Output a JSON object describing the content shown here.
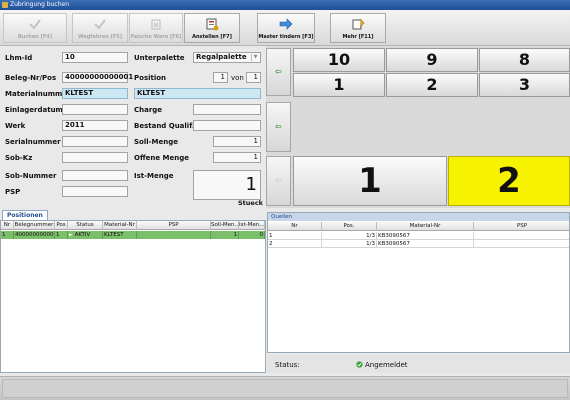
{
  "window": {
    "title": "Zubringung buchen"
  },
  "toolbar": {
    "buttons": [
      {
        "label": "Buchen [F4]",
        "icon": "check-icon",
        "enabled": false
      },
      {
        "label": "Wegfahren [F5]",
        "icon": "check-icon",
        "enabled": false
      },
      {
        "label": "Falsche Ware [F6]",
        "icon": "wrong-goods-icon",
        "enabled": false
      },
      {
        "label": "Anstellen [F7]",
        "icon": "queue-icon",
        "enabled": true
      },
      {
        "label": "Master tindern [F3]",
        "icon": "arrow-right-icon",
        "enabled": true
      },
      {
        "label": "Mehr [F11]",
        "icon": "more-icon",
        "enabled": true
      }
    ]
  },
  "form": {
    "lhm_id": {
      "label": "Lhm-Id",
      "value": "10"
    },
    "unterpalette": {
      "label": "Unterpalette",
      "value": "Regalpalette"
    },
    "beleg": {
      "label": "Beleg-Nr/Pos",
      "value": "40000000000001"
    },
    "position": {
      "label": "Position",
      "value": "1",
      "von_label": "von",
      "von_value": "1"
    },
    "materialnummer": {
      "label": "Materialnummer",
      "value": "KLTEST"
    },
    "material_text": {
      "value": "KLTEST"
    },
    "einlagerdatum": {
      "label": "Einlagerdatum",
      "value": ""
    },
    "charge": {
      "label": "Charge",
      "value": ""
    },
    "werk": {
      "label": "Werk",
      "value": "2011"
    },
    "bestand_qualif": {
      "label": "Bestand Qualif.",
      "value": ""
    },
    "serialnummer": {
      "label": "Serialnummer",
      "value": ""
    },
    "soll_menge": {
      "label": "Soll-Menge",
      "value": "1"
    },
    "sob_kz": {
      "label": "Sob-Kz",
      "value": ""
    },
    "offene_menge": {
      "label": "Offene Menge",
      "value": "1"
    },
    "sob_nummer": {
      "label": "Sob-Nummer",
      "value": ""
    },
    "ist_menge": {
      "label": "Ist-Menge",
      "value": "1",
      "unit": "Stueck"
    },
    "psp": {
      "label": "PSP",
      "value": ""
    }
  },
  "numpad": {
    "nav_icons": [
      "arrow-left-icon",
      "arrow-left-icon",
      "arrow-left-icon"
    ],
    "nav_glyph": "⇦",
    "row1": [
      "10",
      "9",
      "8"
    ],
    "row2": [
      "1",
      "2",
      "3"
    ],
    "big": [
      "1",
      "2"
    ],
    "highlight_color": "#f6f200"
  },
  "positionen": {
    "tab_label": "Positionen",
    "columns": [
      "Nr",
      "Belegnummer",
      "Pos",
      "Status",
      "Material-Nr",
      "PSP",
      "Soll-Men...",
      "Ist-Men..."
    ],
    "rows": [
      {
        "nr": "1",
        "belegnummer": "40000000000",
        "pos": "1",
        "status": "AKTIV",
        "material": "KLTEST",
        "psp": "",
        "soll": "1",
        "ist": "0"
      }
    ]
  },
  "quellen": {
    "title": "Quellen",
    "columns": [
      "Nr",
      "Pos.",
      "Material-Nr",
      "PSP"
    ],
    "rows": [
      {
        "nr": "1",
        "pos": "1/3",
        "material": "KB3090567",
        "psp": ""
      },
      {
        "nr": "2",
        "pos": "1/3",
        "material": "KB3090567",
        "psp": ""
      }
    ]
  },
  "status": {
    "label": "Status:",
    "value": "Angemeldet",
    "color": "#3aa53a"
  }
}
